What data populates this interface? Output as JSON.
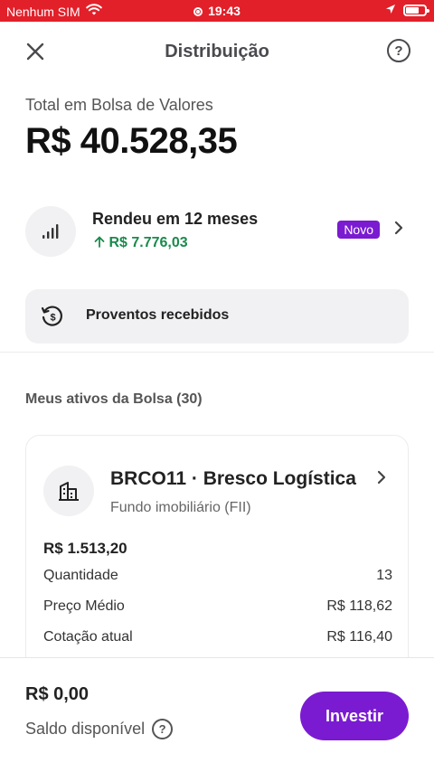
{
  "status_bar": {
    "carrier": "Nenhum SIM",
    "time": "19:43",
    "background_color": "#e2202a"
  },
  "header": {
    "title": "Distribuição",
    "close_icon": "close-icon",
    "help_icon": "help-icon",
    "help_glyph": "?"
  },
  "summary": {
    "label": "Total em Bolsa de Valores",
    "value": "R$ 40.528,35"
  },
  "earnings": {
    "title": "Rendeu em 12 meses",
    "value": "R$ 7.776,03",
    "badge": "Novo",
    "icon": "signal-bars-icon",
    "value_color": "#1a8a4c",
    "badge_color": "#7a1bd1"
  },
  "proventos": {
    "label": "Proventos recebidos",
    "icon": "history-money-icon"
  },
  "assets_section": {
    "title": "Meus ativos da Bolsa (30)"
  },
  "asset": {
    "name": "BRCO11 · Bresco Logística",
    "type": "Fundo imobiliário (FII)",
    "total": "R$ 1.513,20",
    "icon": "building-icon",
    "rows": [
      {
        "label": "Quantidade",
        "value": "13"
      },
      {
        "label": "Preço Médio",
        "value": "R$ 118,62"
      },
      {
        "label": "Cotação atual",
        "value": "R$ 116,40"
      }
    ]
  },
  "footer": {
    "balance_value": "R$ 0,00",
    "balance_label": "Saldo disponível",
    "help_glyph": "?",
    "invest_label": "Investir",
    "accent_color": "#7a1bd1"
  }
}
